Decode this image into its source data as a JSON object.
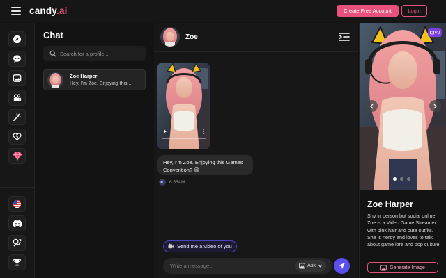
{
  "header": {
    "brand": "candy",
    "brand_tld": ".ai",
    "create_account_label": "Create Free Account",
    "login_label": "Login"
  },
  "rail": {
    "top_icons": [
      "compass-icon",
      "chat-bubble-icon",
      "gallery-icon",
      "camera-icon",
      "magic-wand-icon",
      "heart-icon",
      "diamond-icon"
    ],
    "bottom_icons": [
      "us-flag-icon",
      "discord-icon",
      "affiliate-icon",
      "trophy-icon"
    ]
  },
  "chatlist": {
    "title": "Chat",
    "search_placeholder": "Search for a profile...",
    "items": [
      {
        "name": "Zoe Harper",
        "preview": "Hey, I'm Zoe. Enjoying this..."
      }
    ]
  },
  "chat": {
    "character_name": "Zoe",
    "message_text": "Hey, I'm Zoe. Enjoying this Games Convention? 😉",
    "message_time": "6:55AM",
    "suggestion": "Send me a video of you",
    "input_placeholder": "Write a message...",
    "ask_label": "Ask"
  },
  "profile": {
    "version_badge": "V2",
    "name": "Zoe Harper",
    "bio": "Shy in person but social online, Zoe is a Video Game Streamer with pink hair and cute outfits. She is nerdy and loves to talk about game lore and pop culture.",
    "generate_label": "Generate Image",
    "carousel": {
      "count": 3,
      "active": 1
    }
  },
  "colors": {
    "accent_pink": "#e8517c",
    "accent_purple": "#5b4ff0",
    "background": "#131313"
  }
}
